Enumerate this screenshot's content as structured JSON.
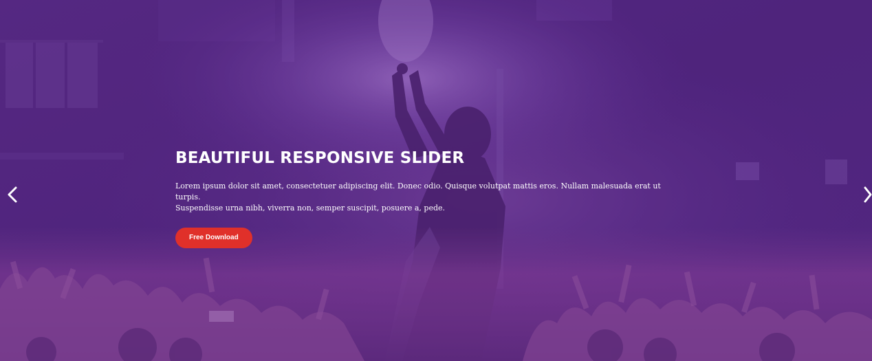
{
  "slide": {
    "title": "BEAUTIFUL RESPONSIVE SLIDER",
    "description_line1": "Lorem ipsum dolor sit amet, consectetuer adipiscing elit. Donec odio. Quisque volutpat mattis eros. Nullam malesuada erat ut turpis.",
    "description_line2": "Suspendisse urna nibh, viverra non, semper suscipit, posuere a, pede.",
    "cta_label": "Free Download"
  },
  "navigation": {
    "prev_icon": "chevron-left-icon",
    "next_icon": "chevron-right-icon"
  },
  "colors": {
    "overlay": "#5a2a8c",
    "cta": "#e0302a",
    "text": "#ffffff"
  }
}
